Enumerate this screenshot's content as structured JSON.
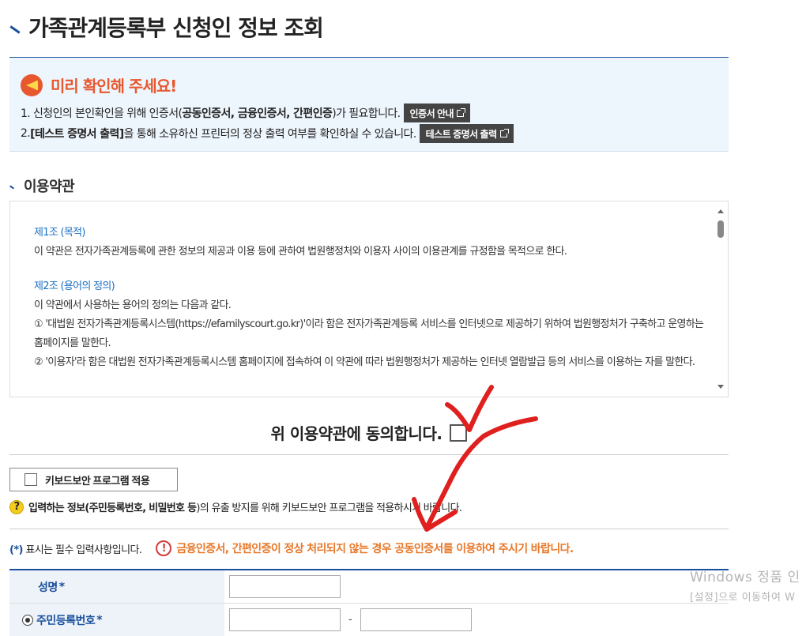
{
  "page": {
    "title": "가족관계등록부 신청인 정보 조회"
  },
  "notice": {
    "title": "미리 확인해 주세요!",
    "line1_a": "1. 신청인의 본인확인을 위해 인증서(",
    "line1_b": "공동인증서, 금융인증서, 간편인증",
    "line1_c": ")가 필요합니다.",
    "line1_button": "인증서 안내",
    "line2_a": "2. ",
    "line2_b": "[테스트 증명서 출력]",
    "line2_c": "을 통해 소유하신 프린터의 정상 출력 여부를 확인하실 수 있습니다.",
    "line2_button": "테스트 증명서 출력"
  },
  "terms": {
    "section_title": "이용약관",
    "art1_title": "제1조 (목적)",
    "art1_body": "이 약관은 전자가족관계등록에 관한 정보의 제공과 이용 등에 관하여 법원행정처와 이용자 사이의 이용관계를 규정함을 목적으로 한다.",
    "art2_title": "제2조 (용어의 정의)",
    "art2_body": "이 약관에서 사용하는 용어의 정의는 다음과 같다.",
    "art2_item1": "① '대법원 전자가족관계등록시스템(https://efamilyscourt.go.kr)'이라 함은 전자가족관계등록 서비스를 인터넷으로 제공하기 위하여 법원행정처가 구축하고 운영하는 홈페이지를 말한다.",
    "art2_item2": "② '이용자'라 함은 대법원 전자가족관계등록시스템 홈페이지에 접속하여 이 약관에 따라 법원행정처가 제공하는 인터넷 열람발급 등의 서비스를 이용하는 자를 말한다."
  },
  "agree": {
    "label": "위 이용약관에 동의합니다.",
    "checked": false
  },
  "keyboard_security": {
    "button_label": "키보드보안 프로그램 적용",
    "note_a": "입력하는 정보(",
    "note_b": "주민등록번호, 비밀번호 등",
    "note_c": ")의 유출 방지를 위해 키보드보안 프로그램을 적용하시기 바랍니다."
  },
  "required_note": {
    "mark": "(*)",
    "text": " 표시는 필수 입력사항입니다.",
    "warning": "금융인증서, 간편인증이 정상 처리되지 않는 경우 공동인증서를 이용하여 주시기 바랍니다."
  },
  "form": {
    "name_label": "성명",
    "rrn_label": "주민등록번호",
    "required_mark": "*",
    "rrn_separator": "-"
  },
  "watermark": {
    "line1": "Windows 정품 인",
    "line2": "[설정]으로 이동하여 W"
  },
  "colors": {
    "accent": "#1a4f9c",
    "notice": "#e8582e",
    "warning": "#e8782a",
    "annotation": "#e0201e"
  }
}
